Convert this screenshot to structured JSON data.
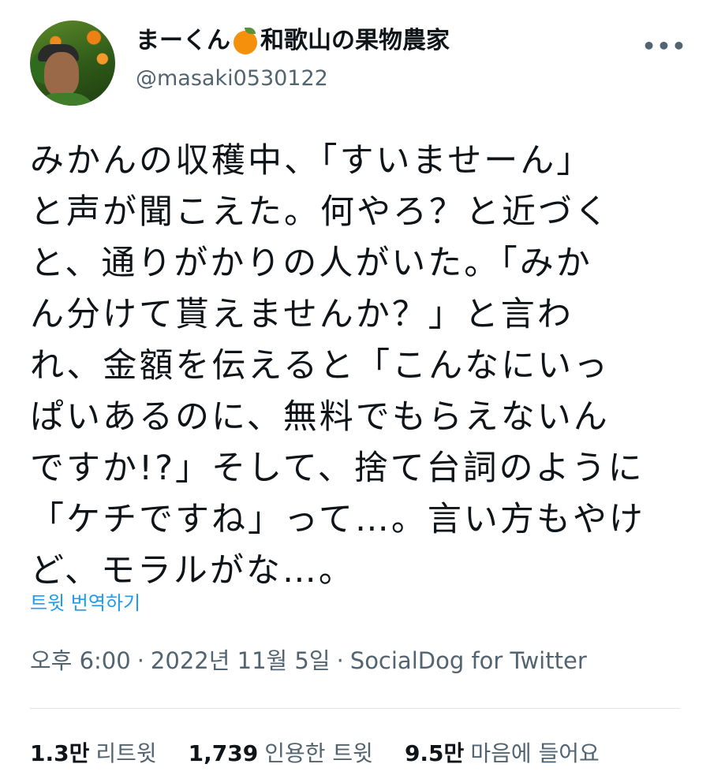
{
  "user": {
    "display_name_prefix": "まーくん",
    "display_name_suffix": "和歌山の果物農家",
    "name_icon": "orange-emoji",
    "handle": "@masaki0530122"
  },
  "more_label": "•••",
  "tweet": {
    "lines": [
      "みかんの収穫中、「すいませーん」",
      "と声が聞こえた。何やろ？と近づく",
      "と、通りがかりの人がいた。「みか",
      "ん分けて貰えませんか？」と言わ",
      "れ、金額を伝えると「こんなにいっ",
      "ぱいあるのに、無料でもらえないん",
      "ですか!?」そして、捨て台詞のように",
      "「ケチですね」って…。言い方もやけ",
      "ど、モラルがな…。"
    ],
    "translate_label": "트윗 번역하기",
    "time": "오후 6:00",
    "date": "2022년 11월 5일",
    "source": "SocialDog for Twitter",
    "separator": "·"
  },
  "stats": {
    "retweets_value": "1.3만",
    "retweets_label": "리트윗",
    "quotes_value": "1,739",
    "quotes_label": "인용한 트윗",
    "likes_value": "9.5만",
    "likes_label": "마음에 들어요"
  },
  "colors": {
    "text": "#0f1419",
    "secondary": "#536471",
    "link": "#1d9bf0",
    "divider": "#dfe3e7",
    "orange": "#f4900c"
  }
}
